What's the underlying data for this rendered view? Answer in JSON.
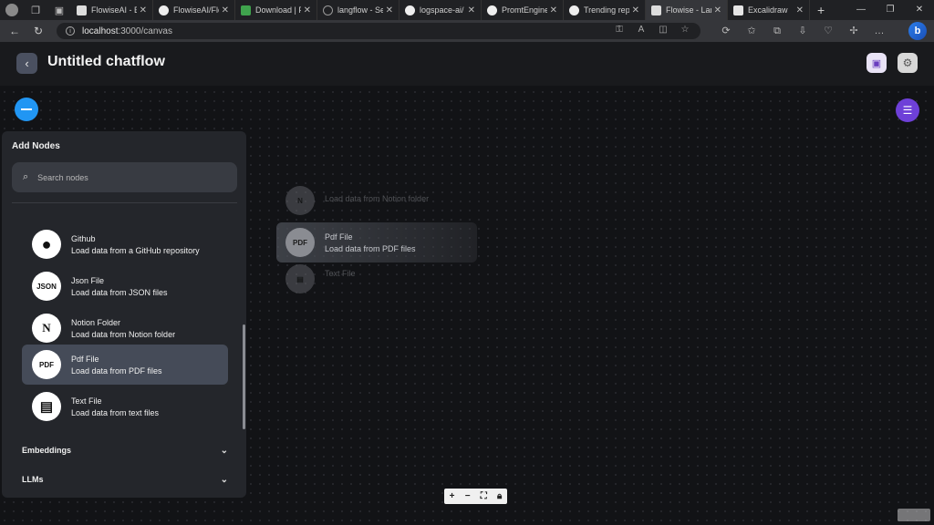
{
  "browser": {
    "tabs": [
      {
        "title": "FlowiseAI - E",
        "icon": "doc-icon"
      },
      {
        "title": "FlowiseAI/Flo",
        "icon": "github-icon"
      },
      {
        "title": "Download | F",
        "icon": "download-icon"
      },
      {
        "title": "langflow - Se",
        "icon": "search-icon"
      },
      {
        "title": "logspace-ai/",
        "icon": "github-icon"
      },
      {
        "title": "PromtEngine",
        "icon": "github-icon"
      },
      {
        "title": "Trending rep",
        "icon": "github-icon"
      },
      {
        "title": "Flowise - Lan",
        "icon": "doc-icon",
        "active": true
      },
      {
        "title": "Excalidraw",
        "icon": "excalidraw-icon"
      }
    ],
    "url_host": "localhost",
    "url_path": ":3000/canvas"
  },
  "header": {
    "title": "Untitled chatflow"
  },
  "panel": {
    "title": "Add Nodes",
    "search_placeholder": "Search nodes",
    "nodes": [
      {
        "name": "Github",
        "desc": "Load data from a GitHub repository",
        "icon": "github-icon",
        "glyph": "●"
      },
      {
        "name": "Json File",
        "desc": "Load data from JSON files",
        "icon": "json-icon",
        "glyph": "JSON"
      },
      {
        "name": "Notion Folder",
        "desc": "Load data from Notion folder",
        "icon": "notion-icon",
        "glyph": "N"
      },
      {
        "name": "Pdf File",
        "desc": "Load data from PDF files",
        "icon": "pdf-icon",
        "glyph": "PDF",
        "selected": true
      },
      {
        "name": "Text File",
        "desc": "Load data from text files",
        "icon": "clipboard-icon",
        "glyph": "▤"
      }
    ],
    "categories": [
      {
        "label": "Embeddings"
      },
      {
        "label": "LLMs"
      }
    ]
  },
  "drag_ghost": {
    "rows": [
      {
        "name": "",
        "desc": "Load data from Notion folder",
        "glyph": "N"
      },
      {
        "name": "Pdf File",
        "desc": "Load data from PDF files",
        "glyph": "PDF"
      },
      {
        "name": "Text File",
        "desc": "",
        "glyph": "▤"
      }
    ]
  },
  "colors": {
    "accent_blue": "#2196f3",
    "accent_purple": "#6e40d8",
    "panel_bg": "#24262b"
  }
}
